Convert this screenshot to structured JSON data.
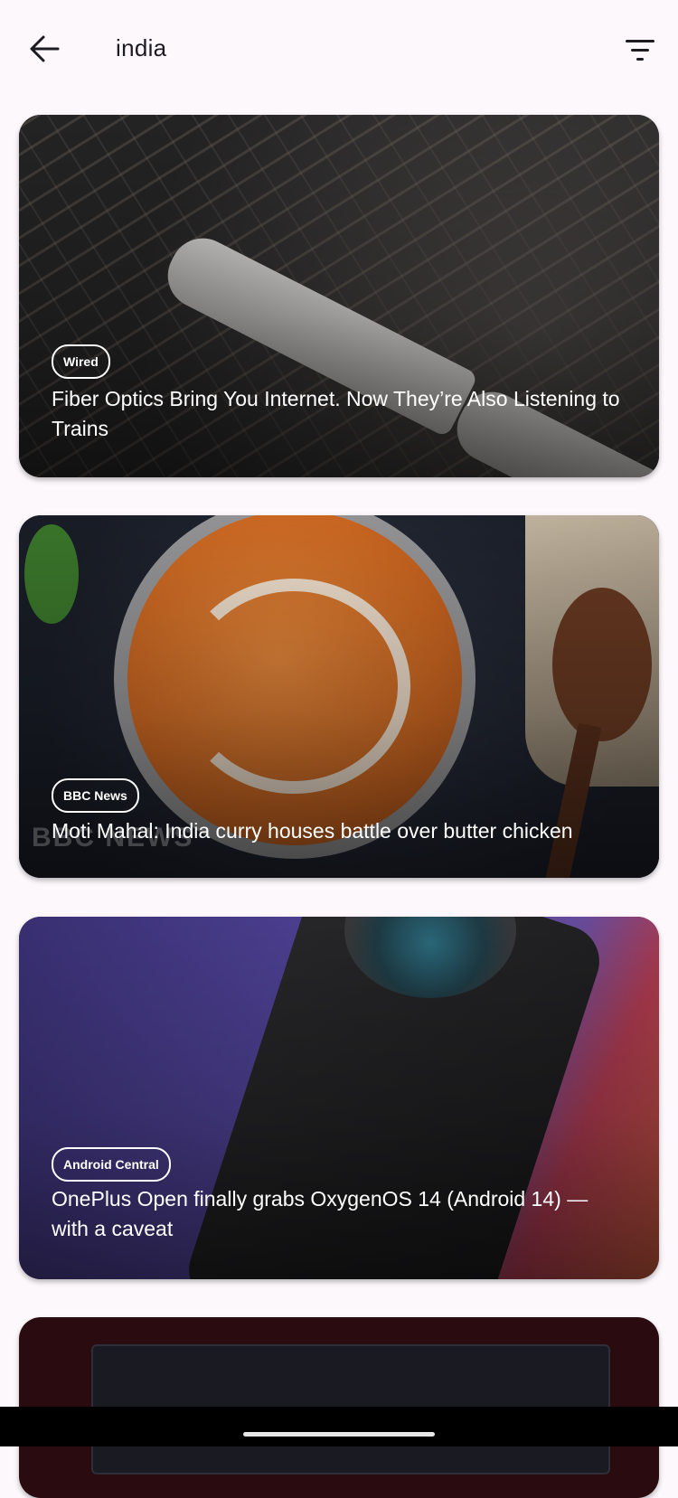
{
  "header": {
    "query": "india",
    "back_icon": "arrow-left-icon",
    "filter_icon": "filter-icon"
  },
  "articles": [
    {
      "source": "Wired",
      "title": "Fiber Optics Bring You Internet. Now They’re Also Listening to Trains"
    },
    {
      "source": "BBC News",
      "title": "Moti Mahal: India curry houses battle over butter chicken",
      "image_watermark": "BBC NEWS"
    },
    {
      "source": "Android Central",
      "title": "OnePlus Open finally grabs OxygenOS 14 (Android 14) — with a caveat"
    }
  ],
  "colors": {
    "background": "#fdf8fc",
    "text": "#1c1b1f",
    "badge_border": "#ffffff"
  }
}
